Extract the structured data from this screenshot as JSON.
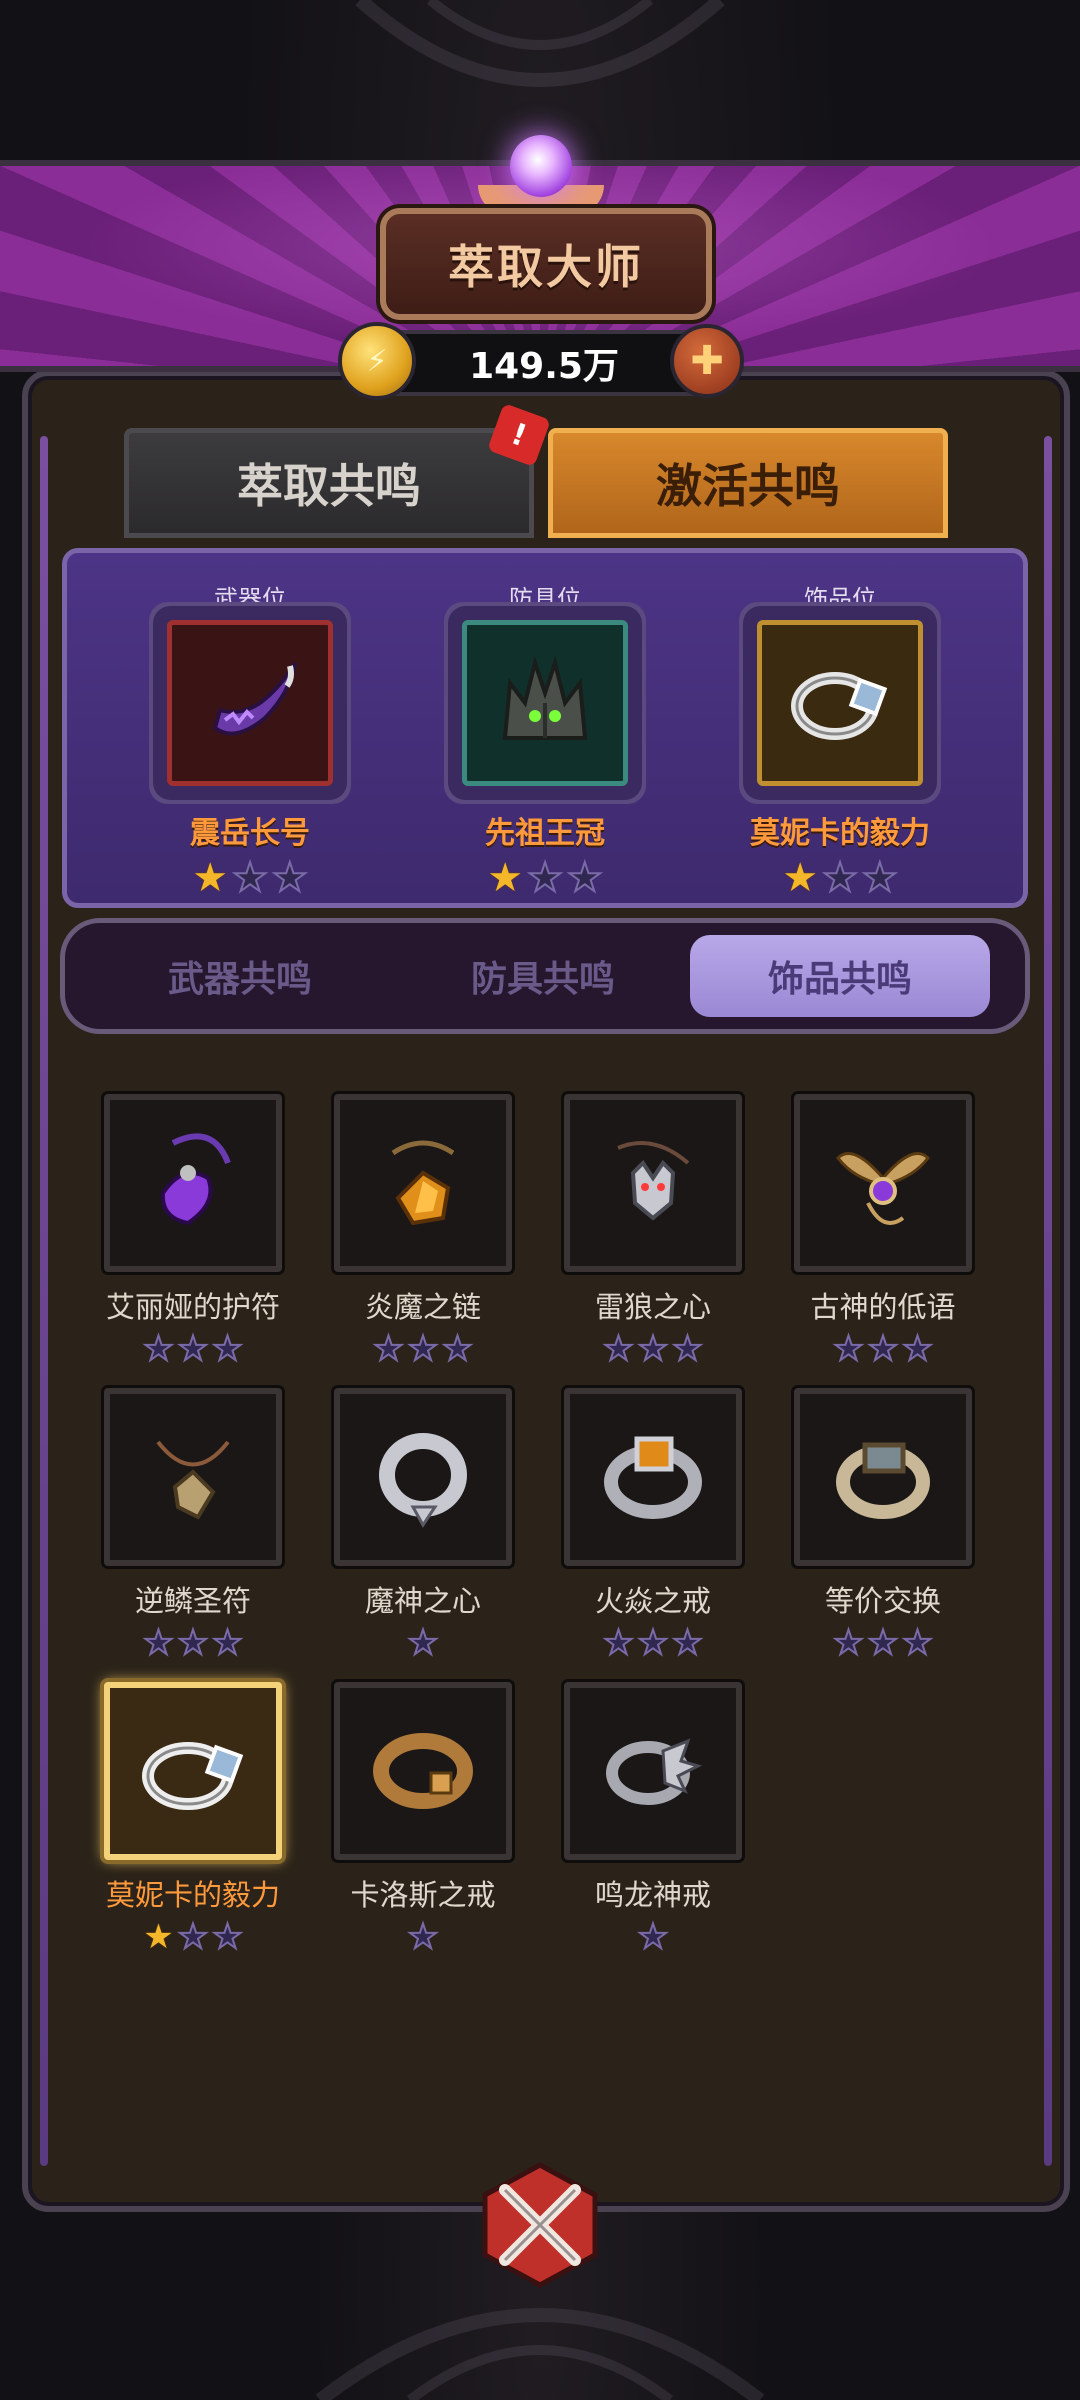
{
  "header": {
    "title": "萃取大师",
    "currency_value": "149.5万"
  },
  "main_tabs": [
    {
      "label": "萃取共鸣",
      "active": false,
      "has_alert": true
    },
    {
      "label": "激活共鸣",
      "active": true
    }
  ],
  "alert_glyph": "!",
  "equip_slots": [
    {
      "label": "武器位",
      "item_name": "震岳长号",
      "stars": 1,
      "max_stars": 3
    },
    {
      "label": "防具位",
      "item_name": "先祖王冠",
      "stars": 1,
      "max_stars": 3
    },
    {
      "label": "饰品位",
      "item_name": "莫妮卡的毅力",
      "stars": 1,
      "max_stars": 3
    }
  ],
  "sub_tabs": [
    {
      "label": "武器共鸣",
      "active": false
    },
    {
      "label": "防具共鸣",
      "active": false
    },
    {
      "label": "饰品共鸣",
      "active": true
    }
  ],
  "items": [
    {
      "name": "艾丽娅的护符",
      "icon": "amulet-purple-icon",
      "stars": 0,
      "max_stars": 3,
      "selected": false
    },
    {
      "name": "炎魔之链",
      "icon": "amulet-amber-icon",
      "stars": 0,
      "max_stars": 3,
      "selected": false
    },
    {
      "name": "雷狼之心",
      "icon": "wolf-pendant-icon",
      "stars": 0,
      "max_stars": 3,
      "selected": false
    },
    {
      "name": "古神的低语",
      "icon": "winged-amulet-icon",
      "stars": 0,
      "max_stars": 3,
      "selected": false
    },
    {
      "name": "逆鳞圣符",
      "icon": "scale-pendant-icon",
      "stars": 0,
      "max_stars": 3,
      "selected": false
    },
    {
      "name": "魔神之心",
      "icon": "silver-ring-icon",
      "stars": 0,
      "max_stars": 1,
      "selected": false
    },
    {
      "name": "火焱之戒",
      "icon": "fire-ring-icon",
      "stars": 0,
      "max_stars": 3,
      "selected": false
    },
    {
      "name": "等价交换",
      "icon": "stone-ring-icon",
      "stars": 0,
      "max_stars": 3,
      "selected": false
    },
    {
      "name": "莫妮卡的毅力",
      "icon": "gem-ring-icon",
      "stars": 1,
      "max_stars": 3,
      "selected": true
    },
    {
      "name": "卡洛斯之戒",
      "icon": "bronze-ring-icon",
      "stars": 0,
      "max_stars": 1,
      "selected": false
    },
    {
      "name": "鸣龙神戒",
      "icon": "dragon-ring-icon",
      "stars": 0,
      "max_stars": 1,
      "selected": false
    }
  ],
  "colors": {
    "star_on": "#f4b72a",
    "star_off": "#302850",
    "item_name_selected": "#ff9a3c",
    "tab_active": "#d8882c"
  }
}
